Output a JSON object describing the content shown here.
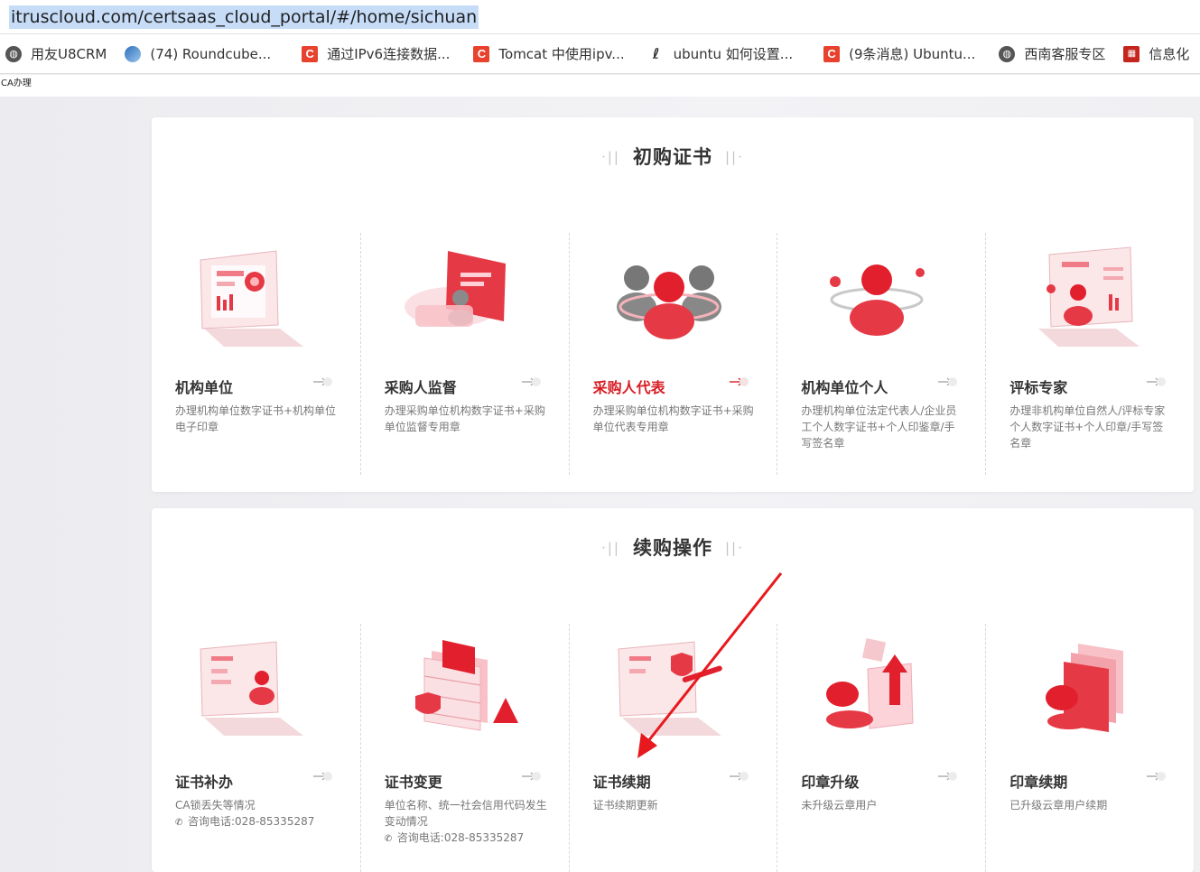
{
  "browser": {
    "url": "itruscloud.com/certsaas_cloud_portal/#/home/sichuan"
  },
  "bookmarks": [
    {
      "label": "用友U8CRM",
      "icon": "globe-icon"
    },
    {
      "label": "(74) Roundcube...",
      "icon": "roundcube-icon"
    },
    {
      "label": "通过IPv6连接数据...",
      "icon": "csdn-icon"
    },
    {
      "label": "Tomcat 中使用ipv...",
      "icon": "csdn-icon"
    },
    {
      "label": "ubuntu 如何设置...",
      "icon": "ubuntu-icon"
    },
    {
      "label": "(9条消息) Ubuntu...",
      "icon": "csdn-icon"
    },
    {
      "label": "西南客服专区",
      "icon": "globe-icon"
    },
    {
      "label": "信息化",
      "icon": "info-icon"
    }
  ],
  "header": {
    "ca_label": "CA办理"
  },
  "sections": [
    {
      "title": "初购证书",
      "items": [
        {
          "title": "机构单位",
          "desc": "办理机构单位数字证书+机构单位电子印章",
          "phone": "",
          "active": false
        },
        {
          "title": "采购人监督",
          "desc": "办理采购单位机构数字证书+采购单位监督专用章",
          "phone": "",
          "active": false
        },
        {
          "title": "采购人代表",
          "desc": "办理采购单位机构数字证书+采购单位代表专用章",
          "phone": "",
          "active": true
        },
        {
          "title": "机构单位个人",
          "desc": "办理机构单位法定代表人/企业员工个人数字证书+个人印鉴章/手写签名章",
          "phone": "",
          "active": false
        },
        {
          "title": "评标专家",
          "desc": "办理非机构单位自然人/评标专家个人数字证书+个人印章/手写签名章",
          "phone": "",
          "active": false
        }
      ]
    },
    {
      "title": "续购操作",
      "items": [
        {
          "title": "证书补办",
          "desc": "CA锁丢失等情况",
          "phone": "咨询电话:028-85335287",
          "active": false
        },
        {
          "title": "证书变更",
          "desc": "单位名称、统一社会信用代码发生变动情况",
          "phone": "咨询电话:028-85335287",
          "active": false
        },
        {
          "title": "证书续期",
          "desc": "证书续期更新",
          "phone": "",
          "active": false
        },
        {
          "title": "印章升级",
          "desc": "未升级云章用户",
          "phone": "",
          "active": false
        },
        {
          "title": "印章续期",
          "desc": "已升级云章用户续期",
          "phone": "",
          "active": false
        }
      ]
    }
  ],
  "colors": {
    "accent": "#d71d24",
    "annotation_arrow": "#e8191e"
  }
}
